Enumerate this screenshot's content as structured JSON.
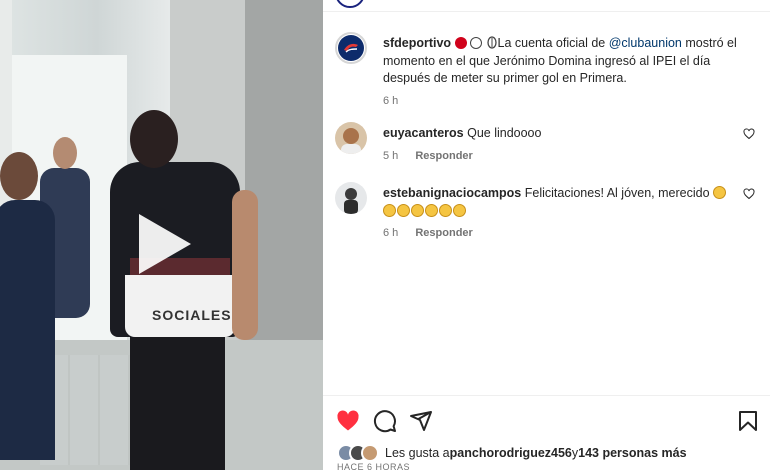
{
  "video": {
    "shirt_text": "SOCIALES",
    "play_icon": "play-icon"
  },
  "post": {
    "owner": {
      "username": "sfdeportivo",
      "caption_pre": "La cuenta oficial de ",
      "mention": "@clubaunion",
      "caption_post": " mostró el momento en el que Jerónimo Domina ingresó al IPEI el día después de meter su primer gol en Primera.",
      "time": "6 h"
    },
    "comments": [
      {
        "username": "euyacanteros",
        "text": "Que lindoooo",
        "time": "5 h",
        "reply_label": "Responder"
      },
      {
        "username": "estebanignaciocampos",
        "text": "Felicitaciones! Al jóven, merecido",
        "time": "6 h",
        "reply_label": "Responder"
      }
    ]
  },
  "actions": {
    "like_icon": "heart-filled-icon",
    "comment_icon": "comment-icon",
    "share_icon": "share-icon",
    "save_icon": "bookmark-icon",
    "like_color": "#ff3040"
  },
  "likes": {
    "prefix": "Les gusta a ",
    "user": "panchorodriguez456",
    "middle": " y ",
    "count": "143 personas más"
  },
  "footer_time": "HACE 6 HORAS"
}
